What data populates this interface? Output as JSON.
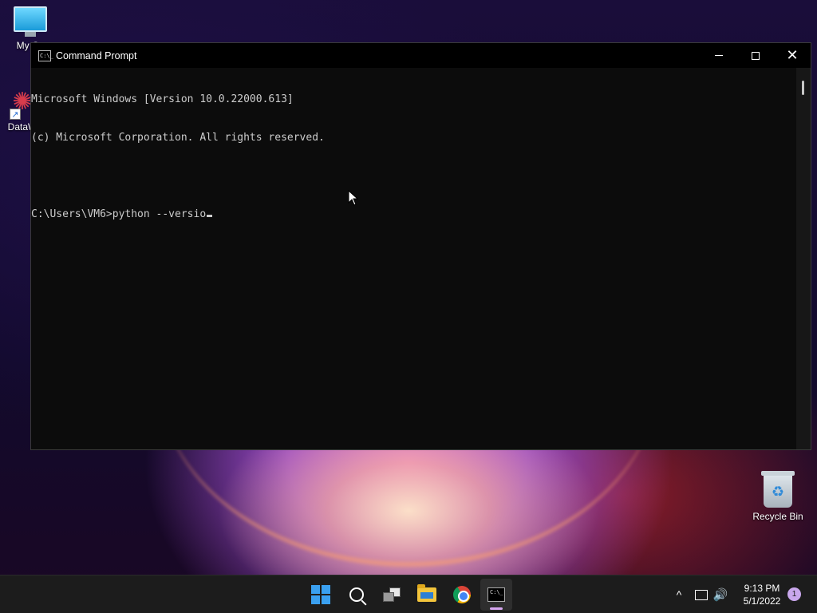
{
  "desktop": {
    "icons": [
      {
        "label": "My Co"
      },
      {
        "label": "DataW"
      },
      {
        "label": "Recycle Bin"
      }
    ]
  },
  "window": {
    "title": "Command Prompt",
    "console_lines": [
      "Microsoft Windows [Version 10.0.22000.613]",
      "(c) Microsoft Corporation. All rights reserved.",
      "",
      "C:\\Users\\VM6>python --versio"
    ]
  },
  "taskbar": {
    "apps": [
      "start-icon",
      "search-icon",
      "task-view-icon",
      "file-explorer-icon",
      "chrome-icon",
      "command-prompt-icon"
    ],
    "active_app": "command-prompt",
    "tray": {
      "chevron": "^",
      "volume_glyph": "🔊",
      "time": "9:13 PM",
      "date": "5/1/2022",
      "notification_count": "1"
    }
  },
  "colors": {
    "console_bg": "#0c0c0c",
    "console_text": "#cccccc",
    "taskbar_bg": "#1c1c1c",
    "accent": "#3aa0f0"
  }
}
